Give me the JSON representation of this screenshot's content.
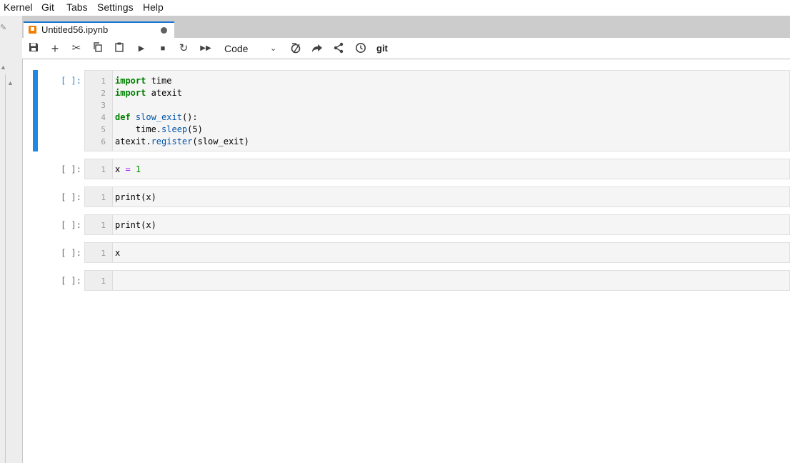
{
  "menu": [
    "Kernel",
    "Git",
    "Tabs",
    "Settings",
    "Help"
  ],
  "tab": {
    "title": "Untitled56.ipynb",
    "icon": "notebook-icon",
    "modified": true
  },
  "toolbar": {
    "icons": [
      "save-icon",
      "add-icon",
      "cut-icon",
      "copy-icon",
      "paste-icon",
      "run-icon",
      "stop-icon",
      "restart-icon",
      "run-all-icon",
      "format-icon",
      "share-icon",
      "git-share-icon",
      "history-icon"
    ],
    "cell_type": "Code",
    "git_label": "git"
  },
  "cells": [
    {
      "prompt": "[ ]:",
      "lines": [
        "1",
        "2",
        "3",
        "4",
        "5",
        "6"
      ]
    },
    {
      "prompt": "[ ]:",
      "lines": [
        "1"
      ]
    },
    {
      "prompt": "[ ]:",
      "lines": [
        "1"
      ]
    },
    {
      "prompt": "[ ]:",
      "lines": [
        "1"
      ]
    },
    {
      "prompt": "[ ]:",
      "lines": [
        "1"
      ]
    },
    {
      "prompt": "[ ]:",
      "lines": [
        "1"
      ]
    }
  ],
  "code": {
    "c0": {
      "import1": "import",
      "time": " time",
      "import2": "import",
      "atexit": " atexit",
      "def": "def",
      "slow_exit": " slow_exit",
      "defsig": "():",
      "time2": "    time.",
      "sleep": "sleep",
      "sleeparg": "(5)",
      "atexit2": "atexit.",
      "register": "register",
      "regarg": "(slow_exit)"
    },
    "c1": {
      "x": "x ",
      "eq": "=",
      "one": " 1"
    },
    "c2": {
      "text": "print(x)"
    },
    "c3": {
      "text": "print(x)"
    },
    "c4": {
      "text": "x"
    },
    "c5": {
      "text": ""
    }
  },
  "colors": {
    "accent": "#1976d2",
    "active_cell": "#1e88e5",
    "tab_icon": "#f57c00"
  }
}
